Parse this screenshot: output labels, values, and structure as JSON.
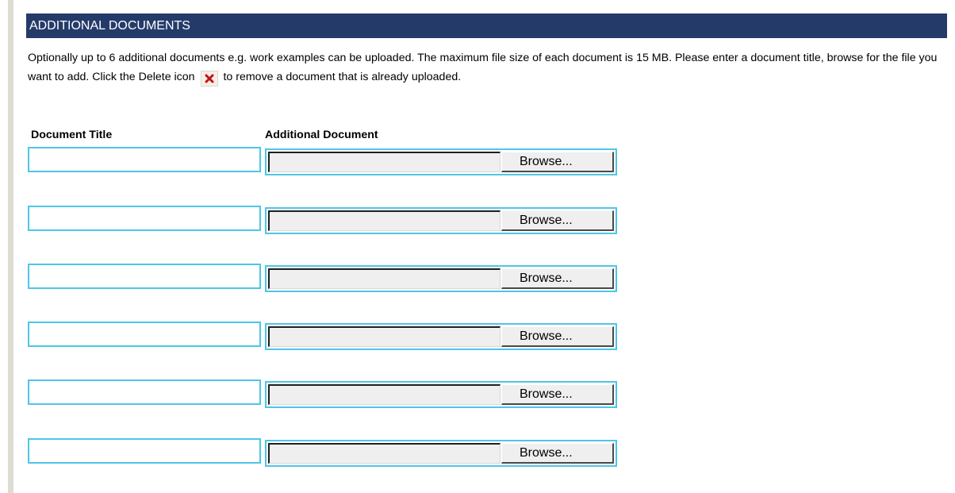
{
  "section": {
    "header": "ADDITIONAL DOCUMENTS",
    "instructions_part1": "Optionally up to 6 additional documents e.g. work examples can be uploaded. The maximum file size of each document is 15 MB. Please enter a document title, browse for the file you want to add. Click the Delete icon",
    "instructions_part2": "to remove a document that is already uploaded.",
    "delete_icon": "close-x-icon",
    "colors": {
      "header_bg": "#243b6a",
      "input_border": "#4ec6e6",
      "delete_icon": "#c0141b"
    }
  },
  "columns": {
    "title": "Document Title",
    "document": "Additional Document"
  },
  "rows": [
    {
      "title_value": "",
      "file_value": "",
      "browse_label": "Browse..."
    },
    {
      "title_value": "",
      "file_value": "",
      "browse_label": "Browse..."
    },
    {
      "title_value": "",
      "file_value": "",
      "browse_label": "Browse..."
    },
    {
      "title_value": "",
      "file_value": "",
      "browse_label": "Browse..."
    },
    {
      "title_value": "",
      "file_value": "",
      "browse_label": "Browse..."
    },
    {
      "title_value": "",
      "file_value": "",
      "browse_label": "Browse..."
    }
  ]
}
